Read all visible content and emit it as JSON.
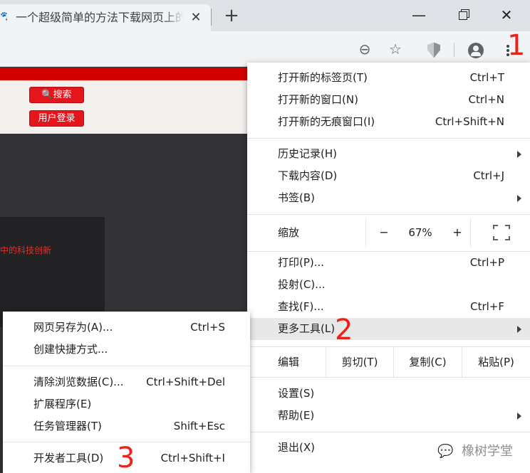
{
  "tab": {
    "title": "一个超级简单的方法下载网页上的",
    "favicon": "paw-icon",
    "close": "✕",
    "new_tab": "+"
  },
  "window": {
    "minimize": "—",
    "close": "✕"
  },
  "toolbar": {
    "zoom_icon": "⊖",
    "star_icon": "☆"
  },
  "page": {
    "search_button": "🔍搜索",
    "login_button": "用户登录",
    "panel_text": "中的科技创新",
    "colors": {
      "red": "#d30000",
      "button": "#e4161c"
    }
  },
  "main_menu": {
    "items": [
      {
        "label": "打开新的标签页(T)",
        "shortcut": "Ctrl+T"
      },
      {
        "label": "打开新的窗口(N)",
        "shortcut": "Ctrl+N"
      },
      {
        "label": "打开新的无痕窗口(I)",
        "shortcut": "Ctrl+Shift+N"
      },
      {
        "label": "历史记录(H)"
      },
      {
        "label": "下载内容(D)",
        "shortcut": "Ctrl+J"
      },
      {
        "label": "书签(B)"
      },
      {
        "label": "打印(P)...",
        "shortcut": "Ctrl+P"
      },
      {
        "label": "投射(C)..."
      },
      {
        "label": "查找(F)...",
        "shortcut": "Ctrl+F"
      },
      {
        "label": "更多工具(L)"
      },
      {
        "label": "设置(S)"
      },
      {
        "label": "帮助(E)"
      },
      {
        "label": "退出(X)"
      }
    ],
    "zoom": {
      "label": "缩放",
      "minus": "−",
      "value": "67%",
      "plus": "+"
    },
    "edit": {
      "label": "编辑",
      "cut": "剪切(T)",
      "copy": "复制(C)",
      "paste": "粘贴(P)"
    }
  },
  "sub_menu": {
    "items": [
      {
        "label": "网页另存为(A)...",
        "shortcut": "Ctrl+S"
      },
      {
        "label": "创建快捷方式..."
      },
      {
        "label": "清除浏览数据(C)...",
        "shortcut": "Ctrl+Shift+Del"
      },
      {
        "label": "扩展程序(E)"
      },
      {
        "label": "任务管理器(T)",
        "shortcut": "Shift+Esc"
      },
      {
        "label": "开发者工具(D)",
        "shortcut": "Ctrl+Shift+I"
      }
    ]
  },
  "annotations": {
    "step1": "1",
    "step2": "2",
    "step3": "3"
  },
  "watermark": {
    "text": "橡树学堂",
    "icon": "wechat-icon"
  }
}
